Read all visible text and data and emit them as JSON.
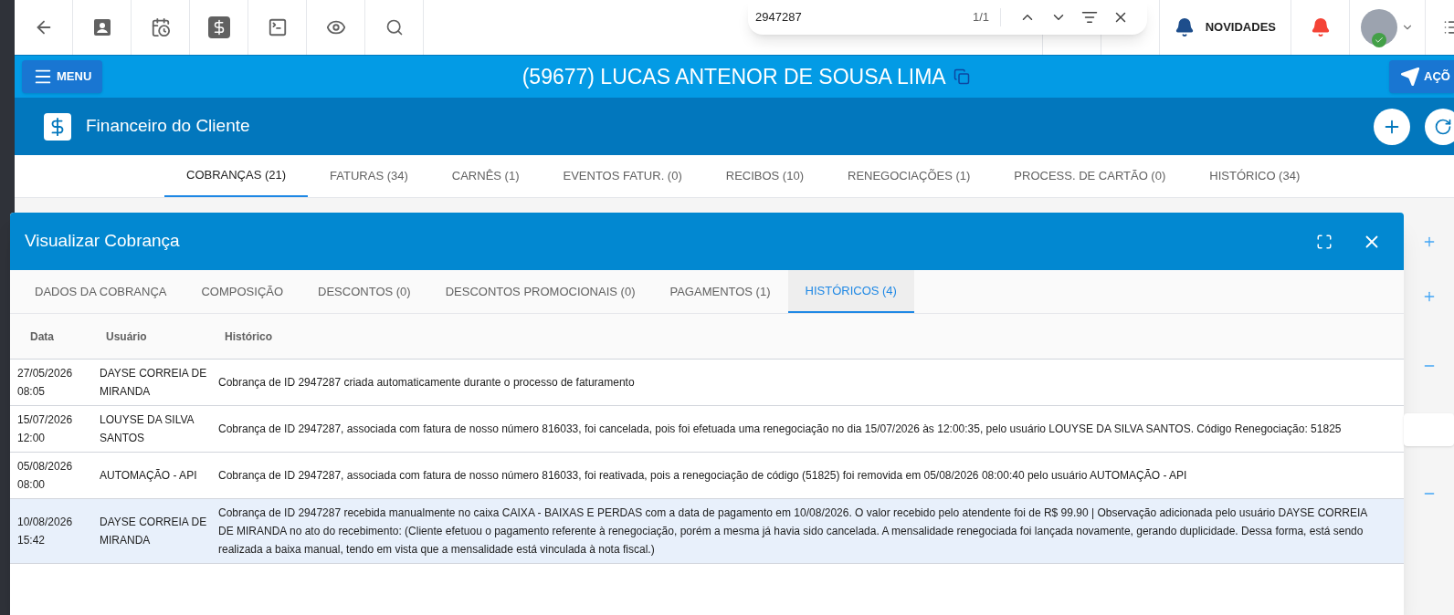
{
  "find_bar": {
    "value": "2947287",
    "count": "1/1"
  },
  "topbar": {
    "news_label": "NOVIDADES"
  },
  "header": {
    "menu_label": "MENU",
    "client_title": "(59677) LUCAS ANTENOR DE SOUSA LIMA",
    "actions_label": "AÇÕ"
  },
  "section": {
    "title": "Financeiro do Cliente"
  },
  "tabs": [
    {
      "label": "COBRANÇAS (21)",
      "selected": true
    },
    {
      "label": "FATURAS (34)",
      "selected": false
    },
    {
      "label": "CARNÊS (1)",
      "selected": false
    },
    {
      "label": "EVENTOS FATUR. (0)",
      "selected": false
    },
    {
      "label": "RECIBOS (10)",
      "selected": false
    },
    {
      "label": "RENEGOCIAÇÕES (1)",
      "selected": false
    },
    {
      "label": "PROCESS. DE CARTÃO (0)",
      "selected": false
    },
    {
      "label": "HISTÓRICO (34)",
      "selected": false
    }
  ],
  "dialog": {
    "title": "Visualizar Cobrança",
    "tabs": [
      {
        "label": "DADOS DA COBRANÇA",
        "selected": false
      },
      {
        "label": "COMPOSIÇÃO",
        "selected": false
      },
      {
        "label": "DESCONTOS (0)",
        "selected": false
      },
      {
        "label": "DESCONTOS PROMOCIONAIS (0)",
        "selected": false
      },
      {
        "label": "PAGAMENTOS (1)",
        "selected": false
      },
      {
        "label": "HISTÓRICOS (4)",
        "selected": true
      }
    ],
    "table": {
      "columns": [
        "Data",
        "Usuário",
        "Histórico"
      ],
      "rows": [
        {
          "date": "27/05/2026 08:05",
          "user": "DAYSE CORREIA DE MIRANDA",
          "history": "Cobrança de ID 2947287 criada automaticamente durante o processo de faturamento",
          "highlighted": false
        },
        {
          "date": "15/07/2026 12:00",
          "user": "LOUYSE DA SILVA SANTOS",
          "history": "Cobrança de ID 2947287, associada com fatura de nosso número 816033, foi cancelada, pois foi efetuada uma renegociação no dia 15/07/2026 às 12:00:35, pelo usuário LOUYSE DA SILVA SANTOS. Código Renegociação: 51825",
          "highlighted": false
        },
        {
          "date": "05/08/2026 08:00",
          "user": "AUTOMAÇÃO - API",
          "history": "Cobrança de ID 2947287, associada com fatura de nosso número 816033, foi reativada, pois a renegociação de código (51825) foi removida em 05/08/2026 08:00:40 pelo usuário AUTOMAÇÃO - API",
          "highlighted": false
        },
        {
          "date": "10/08/2026 15:42",
          "user": "DAYSE CORREIA DE MIRANDA",
          "history": "Cobrança de ID 2947287 recebida manualmente no caixa CAIXA - BAIXAS E PERDAS com a data de pagamento em 10/08/2026. O valor recebido pelo atendente foi de R$ 99.90 | Observação adicionada pelo usuário DAYSE CORREIA DE MIRANDA no ato do recebimento: (Cliente efetuou o pagamento referente à renegociação, porém a mesma já havia sido cancelada. A mensalidade renegociada foi lançada novamente, gerando duplicidade. Dessa forma, está sendo realizada a baixa manual, tendo em vista que a mensalidade está vinculada à nota fiscal.)",
          "highlighted": true
        }
      ]
    }
  }
}
